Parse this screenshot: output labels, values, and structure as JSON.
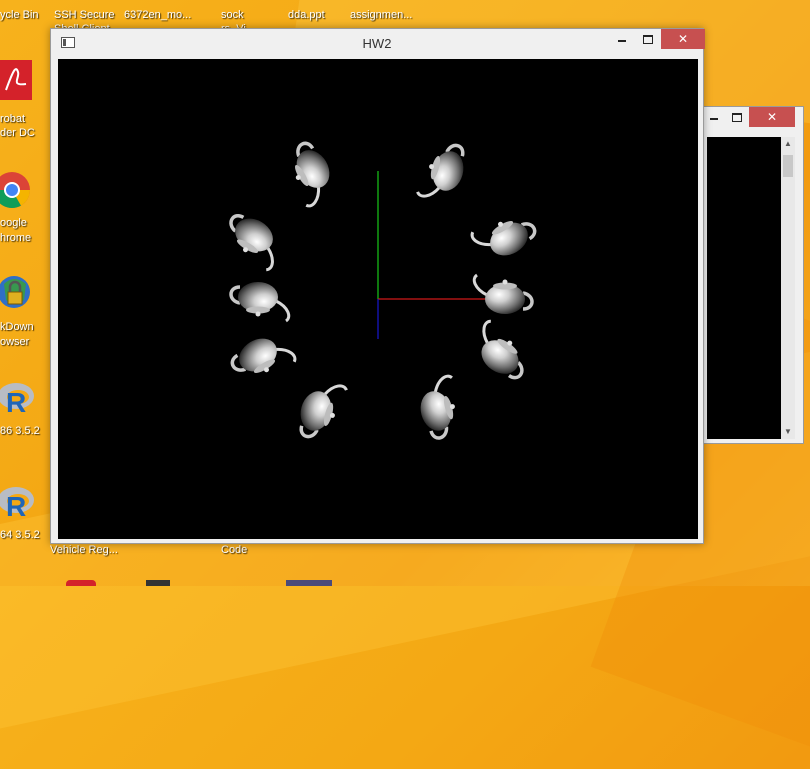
{
  "desktop": {
    "labels": {
      "recycle_bin": "ycle Bin",
      "ssh_secure": "SSH Secure",
      "ssh_secure2": "Shell Client",
      "file_6372": "6372en_mo...",
      "sock": "sock",
      "sock2": "rs_Vi...",
      "dda": "dda.ppt",
      "assignment": "assignmen...",
      "acrobat1": "robat",
      "acrobat2": "der DC",
      "chrome1": "oogle",
      "chrome2": "hrome",
      "lockdown1": "kDown",
      "lockdown2": "owser",
      "r1": "86 3.5.2",
      "r2": "64 3.5.2",
      "vehicle": "Vehicle Reg...",
      "code": "Code"
    },
    "icons": {
      "acrobat": "acrobat-icon",
      "chrome": "chrome-icon",
      "lockdown": "lockdown-browser-icon",
      "r": "r-icon"
    },
    "accent": "#f4a814"
  },
  "main_window": {
    "title": "HW2",
    "buttons": {
      "minimize": "minimize",
      "maximize": "maximize",
      "close": "✕"
    },
    "scene": {
      "background": "#000000",
      "teapot_count": 10,
      "axes": {
        "x_color": "#d01818",
        "y_color": "#18c818",
        "z_color": "#1818d0"
      }
    }
  },
  "console_window": {
    "buttons": {
      "minimize": "minimize",
      "maximize": "maximize",
      "close": "✕"
    },
    "scroll_up": "▲",
    "scroll_down": "▼"
  }
}
